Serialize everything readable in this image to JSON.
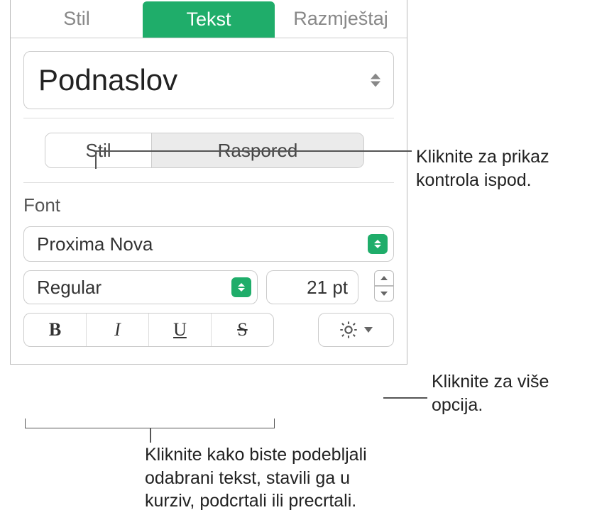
{
  "top_tabs": {
    "stil": "Stil",
    "tekst": "Tekst",
    "razmjestaj": "Razmještaj"
  },
  "paragraph_style": {
    "label": "Podnaslov"
  },
  "sub_tabs": {
    "stil": "Stil",
    "raspored": "Raspored"
  },
  "font_section": {
    "label": "Font",
    "family": "Proxima Nova",
    "typeface": "Regular",
    "size": "21 pt",
    "bold": "B",
    "italic": "I",
    "underline": "U",
    "strike": "S"
  },
  "callouts": {
    "c1": "Kliknite za prikaz kontrola ispod.",
    "c2": "Kliknite za više opcija.",
    "c3": "Kliknite kako biste podebljali odabrani tekst, stavili ga u kurziv, podcrtali ili precrtali."
  }
}
